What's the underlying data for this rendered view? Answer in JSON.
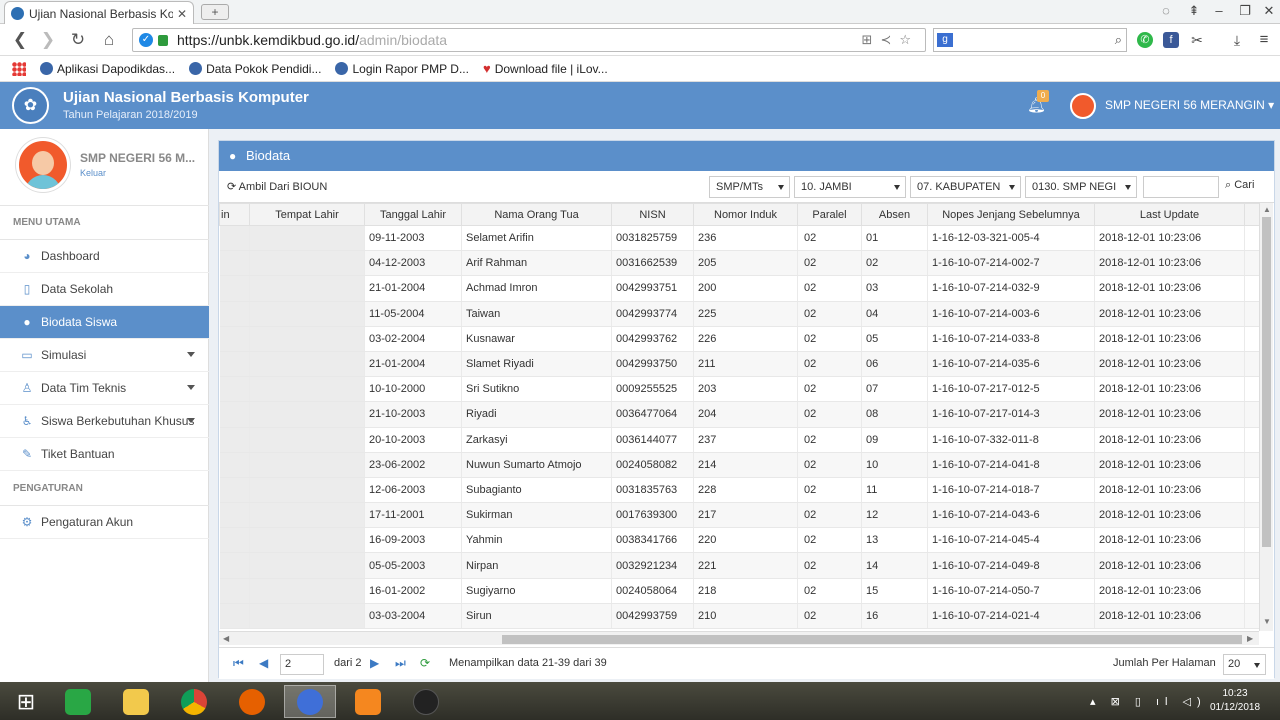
{
  "browser": {
    "tab_title": "Ujian Nasional Berbasis Ko",
    "url_host": "https://unbk.kemdikbud.go.id/",
    "url_path": "admin/biodata",
    "bookmarks": [
      "Aplikasi Dapodikdas...",
      "Data Pokok Pendidi...",
      "Login Rapor PMP D...",
      "Download file | iLov..."
    ]
  },
  "app": {
    "title": "Ujian Nasional Berbasis Komputer",
    "subtitle": "Tahun Pelajaran 2018/2019",
    "notif_count": "0",
    "user_name": "SMP NEGERI 56 MERANGIN"
  },
  "sidebar": {
    "school": "SMP NEGERI 56 M...",
    "logout": "Keluar",
    "menu_header": "MENU UTAMA",
    "settings_header": "PENGATURAN",
    "items": [
      {
        "label": "Dashboard",
        "icon": "dashboard-icon"
      },
      {
        "label": "Data Sekolah",
        "icon": "document-icon"
      },
      {
        "label": "Biodata Siswa",
        "icon": "user-icon"
      },
      {
        "label": "Simulasi",
        "icon": "monitor-icon"
      },
      {
        "label": "Data Tim Teknis",
        "icon": "person-icon"
      },
      {
        "label": "Siswa Berkebutuhan Khusus",
        "icon": "accessibility-icon"
      },
      {
        "label": "Tiket Bantuan",
        "icon": "ticket-icon"
      }
    ],
    "settings_items": [
      {
        "label": "Pengaturan Akun",
        "icon": "gears-icon"
      }
    ]
  },
  "panel": {
    "title": "Biodata",
    "refresh_label": "Ambil Dari BIOUN",
    "filters": [
      "SMP/MTs",
      "10. JAMBI",
      "07. KABUPATEN",
      "0130. SMP NEGI"
    ],
    "search_label": "Cari"
  },
  "table": {
    "columns": [
      "in",
      "Tempat Lahir",
      "Tanggal Lahir",
      "Nama Orang Tua",
      "NISN",
      "Nomor Induk",
      "Paralel",
      "Absen",
      "Nopes Jenjang Sebelumnya",
      "Last Update"
    ],
    "rows": [
      [
        "09-11-2003",
        "Selamet Arifin",
        "0031825759",
        "236",
        "02",
        "01",
        "1-16-12-03-321-005-4",
        "2018-12-01 10:23:06"
      ],
      [
        "04-12-2003",
        "Arif Rahman",
        "0031662539",
        "205",
        "02",
        "02",
        "1-16-10-07-214-002-7",
        "2018-12-01 10:23:06"
      ],
      [
        "21-01-2004",
        "Achmad Imron",
        "0042993751",
        "200",
        "02",
        "03",
        "1-16-10-07-214-032-9",
        "2018-12-01 10:23:06"
      ],
      [
        "11-05-2004",
        "Taiwan",
        "0042993774",
        "225",
        "02",
        "04",
        "1-16-10-07-214-003-6",
        "2018-12-01 10:23:06"
      ],
      [
        "03-02-2004",
        "Kusnawar",
        "0042993762",
        "226",
        "02",
        "05",
        "1-16-10-07-214-033-8",
        "2018-12-01 10:23:06"
      ],
      [
        "21-01-2004",
        "Slamet Riyadi",
        "0042993750",
        "211",
        "02",
        "06",
        "1-16-10-07-214-035-6",
        "2018-12-01 10:23:06"
      ],
      [
        "10-10-2000",
        "Sri Sutikno",
        "0009255525",
        "203",
        "02",
        "07",
        "1-16-10-07-217-012-5",
        "2018-12-01 10:23:06"
      ],
      [
        "21-10-2003",
        "Riyadi",
        "0036477064",
        "204",
        "02",
        "08",
        "1-16-10-07-217-014-3",
        "2018-12-01 10:23:06"
      ],
      [
        "20-10-2003",
        "Zarkasyi",
        "0036144077",
        "237",
        "02",
        "09",
        "1-16-10-07-332-011-8",
        "2018-12-01 10:23:06"
      ],
      [
        "23-06-2002",
        "Nuwun Sumarto Atmojo",
        "0024058082",
        "214",
        "02",
        "10",
        "1-16-10-07-214-041-8",
        "2018-12-01 10:23:06"
      ],
      [
        "12-06-2003",
        "Subagianto",
        "0031835763",
        "228",
        "02",
        "11",
        "1-16-10-07-214-018-7",
        "2018-12-01 10:23:06"
      ],
      [
        "17-11-2001",
        "Sukirman",
        "0017639300",
        "217",
        "02",
        "12",
        "1-16-10-07-214-043-6",
        "2018-12-01 10:23:06"
      ],
      [
        "16-09-2003",
        "Yahmin",
        "0038341766",
        "220",
        "02",
        "13",
        "1-16-10-07-214-045-4",
        "2018-12-01 10:23:06"
      ],
      [
        "05-05-2003",
        "Nirpan",
        "0032921234",
        "221",
        "02",
        "14",
        "1-16-10-07-214-049-8",
        "2018-12-01 10:23:06"
      ],
      [
        "16-01-2002",
        "Sugiyarno",
        "0024058064",
        "218",
        "02",
        "15",
        "1-16-10-07-214-050-7",
        "2018-12-01 10:23:06"
      ],
      [
        "03-03-2004",
        "Sirun",
        "0042993759",
        "210",
        "02",
        "16",
        "1-16-10-07-214-021-4",
        "2018-12-01 10:23:06"
      ]
    ]
  },
  "pager": {
    "page": "2",
    "of": "dari 2",
    "info": "Menampilkan data 21-39 dari 39",
    "per_page_label": "Jumlah Per Halaman",
    "per_page": "20"
  },
  "taskbar": {
    "time": "10:23",
    "date": "01/12/2018"
  },
  "colors": {
    "brand": "#5b8fca",
    "active_item": "#5b8fca"
  }
}
